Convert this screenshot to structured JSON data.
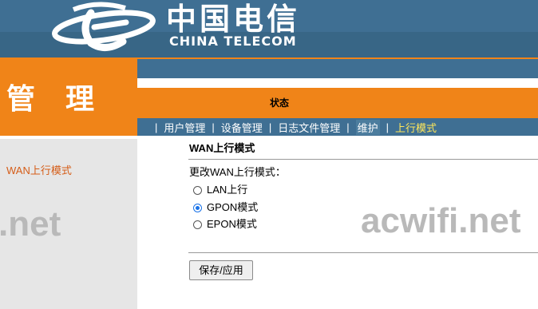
{
  "header": {
    "brand_cn": "中国电信",
    "brand_en": "CHINA TELECOM"
  },
  "sidebar": {
    "title": "管 理",
    "active_link": "WAN上行模式"
  },
  "status_label": "状态",
  "nav": {
    "items": [
      "用户管理",
      "设备管理",
      "日志文件管理",
      "维护",
      "上行模式"
    ],
    "active_index": 4,
    "active_color": "#ffe75a"
  },
  "content": {
    "title": "WAN上行模式",
    "change_label": "更改WAN上行模式：",
    "options": [
      "LAN上行",
      "GPON模式",
      "EPON模式"
    ],
    "selected_index": 1,
    "apply_button": "保存/应用"
  },
  "watermark": {
    "left": ".net",
    "right": "acwifi.net"
  },
  "colors": {
    "orange": "#f08418",
    "blue": "#3f6f93",
    "side_gray": "#e6e6e6",
    "link_orange": "#d55d18"
  }
}
